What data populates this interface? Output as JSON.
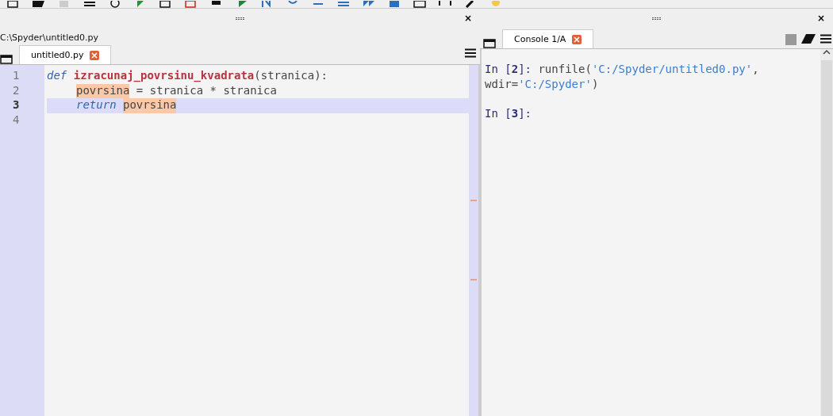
{
  "editor": {
    "close": "×",
    "path": "C:\\Spyder\\untitled0.py",
    "tabs": [
      {
        "label": "untitled0.py",
        "selected": true
      }
    ],
    "lines": [
      {
        "number": "1",
        "current": false,
        "indented": false,
        "tokens": [
          {
            "kind": "keyword",
            "text": "def"
          },
          {
            "kind": "function",
            "text": "izracunaj_povrsinu_kvadrata"
          },
          {
            "kind": "plain",
            "text": "(stranica):"
          }
        ]
      },
      {
        "number": "2",
        "current": false,
        "indented": true,
        "tokens": [
          {
            "kind": "highlight",
            "text": "povrsina"
          },
          {
            "kind": "plain",
            "text": " = stranica * stranica"
          }
        ]
      },
      {
        "number": "3",
        "current": true,
        "indented": true,
        "tokens": [
          {
            "kind": "keyword",
            "text": "return"
          },
          {
            "kind": "highlight",
            "text": "povrsina"
          }
        ]
      },
      {
        "number": "4",
        "current": false,
        "indented": false
      }
    ]
  },
  "console": {
    "close": "×",
    "tabs": [
      {
        "label": "Console 1/A",
        "selected": true
      }
    ],
    "lines": [
      {
        "tokens": [
          {
            "kind": "prompt",
            "text": "In ["
          },
          {
            "kind": "prompt-number",
            "text": "2"
          },
          {
            "kind": "prompt",
            "text": "]:"
          },
          {
            "kind": "plain",
            "text": " runfile("
          },
          {
            "kind": "string",
            "text": "'C:/Spyder/untitled0.py'"
          },
          {
            "kind": "plain",
            "text": ","
          }
        ]
      },
      {
        "tokens": [
          {
            "kind": "plain",
            "text": "wdir="
          },
          {
            "kind": "string",
            "text": "'C:/Spyder'"
          },
          {
            "kind": "plain",
            "text": ")"
          }
        ]
      },
      {
        "spaced": true,
        "tokens": [
          {
            "kind": "prompt",
            "text": "In ["
          },
          {
            "kind": "prompt-number",
            "text": "3"
          },
          {
            "kind": "prompt",
            "text": "]:"
          }
        ]
      }
    ]
  }
}
